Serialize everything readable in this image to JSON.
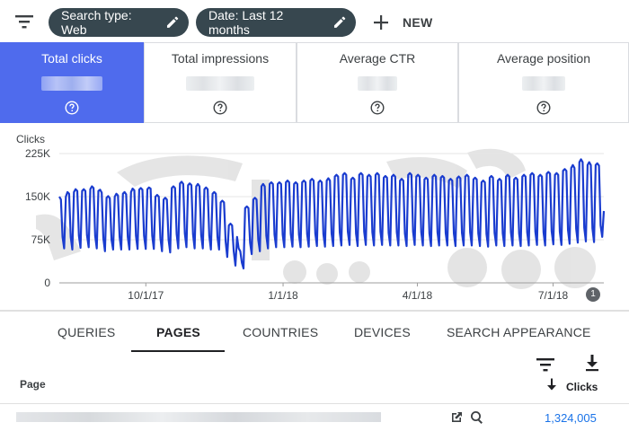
{
  "filters": {
    "search_type_label": "Search type: Web",
    "date_label": "Date: Last 12 months",
    "new_label": "NEW"
  },
  "metrics": [
    {
      "title": "Total clicks",
      "active": true
    },
    {
      "title": "Total impressions",
      "active": false
    },
    {
      "title": "Average CTR",
      "active": false
    },
    {
      "title": "Average position",
      "active": false
    }
  ],
  "colors": {
    "accent": "#4f6bed",
    "line": "#1a3ccf",
    "chip": "#37474f",
    "link": "#1a73e8"
  },
  "chart_data": {
    "type": "line",
    "ylabel": "Clicks",
    "ytick_labels": [
      "0",
      "75K",
      "150K",
      "225K"
    ],
    "yticks": [
      0,
      75000,
      150000,
      225000
    ],
    "ylim": [
      0,
      225000
    ],
    "xtick_labels": [
      "10/1/17",
      "1/1/18",
      "4/1/18",
      "7/1/18"
    ],
    "xtick_days": [
      58,
      150,
      240,
      331
    ],
    "xlim_days": [
      0,
      365
    ],
    "series": [
      {
        "values": [
          150000,
          145000,
          80000,
          60000,
          150000,
          158000,
          155000,
          80000,
          58000,
          158000,
          163000,
          160000,
          82000,
          61000,
          160000,
          163000,
          160000,
          83000,
          62000,
          163000,
          168000,
          165000,
          82000,
          60000,
          160000,
          162000,
          157000,
          78000,
          55000,
          148000,
          151000,
          147000,
          75000,
          58000,
          150000,
          155000,
          152000,
          80000,
          58000,
          155000,
          158000,
          154000,
          80000,
          58000,
          158000,
          164000,
          161000,
          82000,
          59000,
          162000,
          165000,
          162000,
          82000,
          59000,
          163000,
          166000,
          164000,
          82000,
          59000,
          150000,
          153000,
          150000,
          78000,
          55000,
          145000,
          148000,
          145000,
          75000,
          53000,
          165000,
          168000,
          165000,
          85000,
          60000,
          173000,
          176000,
          172000,
          86000,
          62000,
          170000,
          173000,
          170000,
          85000,
          60000,
          168000,
          172000,
          168000,
          83000,
          60000,
          163000,
          166000,
          163000,
          82000,
          58000,
          155000,
          158000,
          155000,
          80000,
          58000,
          140000,
          143000,
          140000,
          72000,
          45000,
          100000,
          103000,
          100000,
          55000,
          30000,
          80000,
          60000,
          55000,
          35000,
          25000,
          130000,
          133000,
          130000,
          70000,
          50000,
          145000,
          148000,
          145000,
          75000,
          55000,
          168000,
          172000,
          168000,
          82000,
          60000,
          172000,
          175000,
          172000,
          84000,
          62000,
          172000,
          175000,
          172000,
          84000,
          62000,
          175000,
          178000,
          175000,
          85000,
          63000,
          172000,
          175000,
          172000,
          84000,
          62000,
          175000,
          178000,
          175000,
          85000,
          63000,
          178000,
          181000,
          178000,
          86000,
          64000,
          175000,
          178000,
          175000,
          85000,
          63000,
          178000,
          182000,
          178000,
          86000,
          64000,
          185000,
          188000,
          185000,
          88000,
          65000,
          188000,
          191000,
          188000,
          89000,
          66000,
          180000,
          183000,
          180000,
          86000,
          64000,
          188000,
          191000,
          188000,
          89000,
          66000,
          185000,
          188000,
          185000,
          88000,
          65000,
          188000,
          191000,
          188000,
          89000,
          66000,
          183000,
          186000,
          183000,
          87000,
          65000,
          185000,
          188000,
          185000,
          88000,
          65000,
          178000,
          181000,
          178000,
          86000,
          64000,
          188000,
          191000,
          188000,
          89000,
          66000,
          185000,
          188000,
          185000,
          88000,
          65000,
          180000,
          183000,
          180000,
          86000,
          64000,
          185000,
          188000,
          185000,
          88000,
          65000,
          183000,
          186000,
          183000,
          87000,
          65000,
          178000,
          181000,
          178000,
          86000,
          64000,
          182000,
          185000,
          182000,
          87000,
          65000,
          185000,
          188000,
          185000,
          88000,
          65000,
          180000,
          183000,
          180000,
          86000,
          64000,
          175000,
          178000,
          175000,
          85000,
          63000,
          183000,
          186000,
          183000,
          87000,
          65000,
          178000,
          181000,
          178000,
          86000,
          64000,
          185000,
          188000,
          185000,
          88000,
          65000,
          180000,
          183000,
          180000,
          86000,
          64000,
          185000,
          188000,
          185000,
          88000,
          65000,
          188000,
          191000,
          188000,
          89000,
          66000,
          185000,
          188000,
          185000,
          88000,
          65000,
          190000,
          193000,
          190000,
          90000,
          67000,
          188000,
          191000,
          188000,
          89000,
          66000,
          195000,
          198000,
          195000,
          92000,
          68000,
          200000,
          205000,
          200000,
          94000,
          70000,
          210000,
          215000,
          210000,
          96000,
          72000,
          205000,
          210000,
          205000,
          95000,
          71000,
          205000,
          208000,
          204000,
          100000,
          80000,
          125000
        ]
      }
    ]
  },
  "annotation_badge": "1",
  "tabs": [
    {
      "label": "QUERIES",
      "active": false
    },
    {
      "label": "PAGES",
      "active": true
    },
    {
      "label": "COUNTRIES",
      "active": false
    },
    {
      "label": "DEVICES",
      "active": false
    },
    {
      "label": "SEARCH APPEARANCE",
      "active": false
    }
  ],
  "table": {
    "col_page": "Page",
    "col_clicks": "Clicks",
    "rows": [
      {
        "clicks": "1,324,005"
      }
    ]
  },
  "icons": {
    "filter": "filter-icon",
    "edit": "pencil-icon",
    "add": "plus-icon",
    "help": "help-icon",
    "download": "download-icon",
    "sort": "arrow-down-icon",
    "open": "open-in-new-icon",
    "inspect": "search-icon"
  }
}
